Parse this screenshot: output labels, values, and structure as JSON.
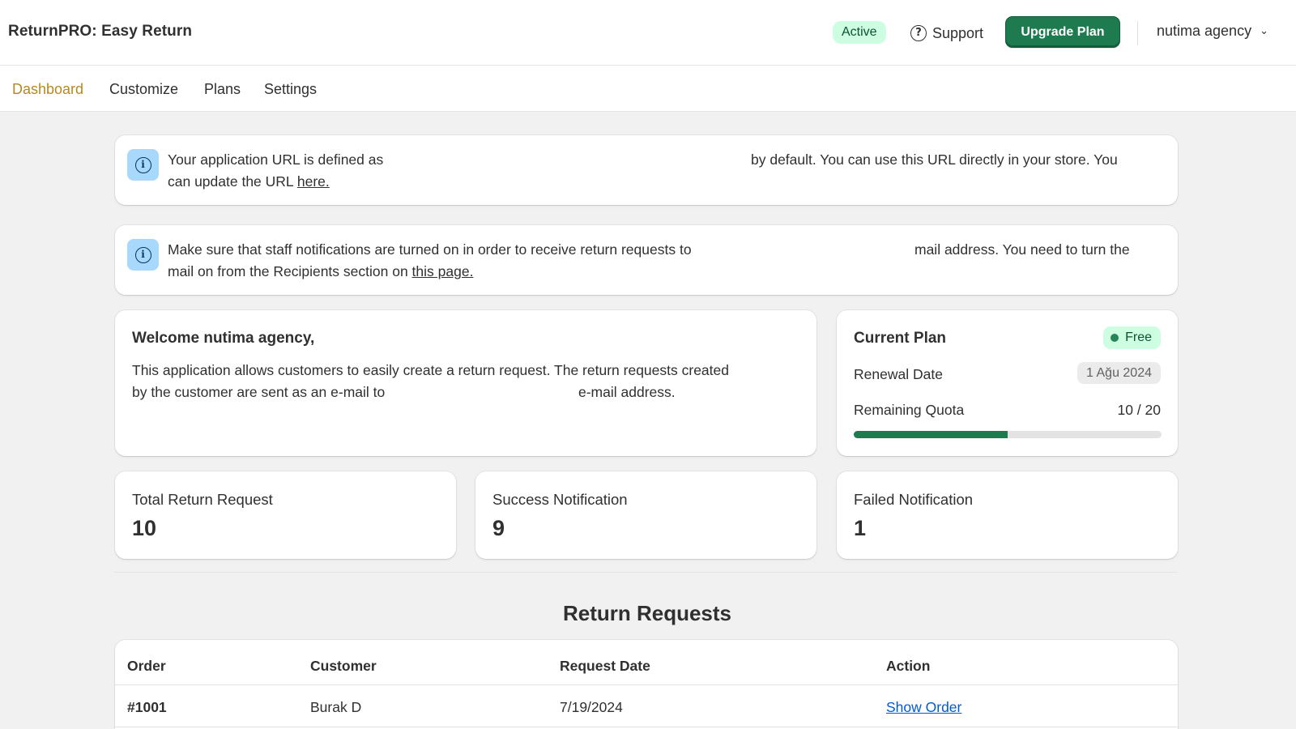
{
  "app": {
    "title": "ReturnPRO: Easy Return",
    "status_badge": "Active",
    "support_label": "Support",
    "upgrade_label": "Upgrade Plan",
    "account_name": "nutima agency"
  },
  "nav": {
    "items": [
      {
        "label": "Dashboard",
        "active": true
      },
      {
        "label": "Customize",
        "active": false
      },
      {
        "label": "Plans",
        "active": false
      },
      {
        "label": "Settings",
        "active": false
      }
    ]
  },
  "banners": {
    "url": {
      "line1_a": "Your application URL is defined as",
      "line1_b": "by default. You can use this URL directly in your store. You",
      "line2_text": "can update the URL ",
      "line2_link": "here."
    },
    "notifications": {
      "line1_a": "Make sure that staff notifications are turned on in order to receive return requests to",
      "line1_b": "mail address. You need to turn the",
      "line2_text": "mail on from the Recipients section on ",
      "line2_link": "this page."
    }
  },
  "welcome": {
    "title": "Welcome nutima agency,",
    "line1": "This application allows customers to easily create a return request. The return requests created",
    "line2_a": "by the customer are sent as an e-mail to",
    "line2_b": "e-mail address."
  },
  "plan": {
    "title": "Current Plan",
    "badge": "Free",
    "renewal_label": "Renewal Date",
    "renewal_date": "1 Ağu 2024",
    "quota_label": "Remaining Quota",
    "quota_value": "10 / 20",
    "quota_used": 10,
    "quota_total": 20,
    "progress_color": "#1e7a4f"
  },
  "stats": [
    {
      "label": "Total Return Request",
      "value": "10"
    },
    {
      "label": "Success Notification",
      "value": "9"
    },
    {
      "label": "Failed Notification",
      "value": "1"
    }
  ],
  "requests": {
    "title": "Return Requests",
    "columns": [
      "Order",
      "Customer",
      "Request Date",
      "Action"
    ],
    "rows": [
      {
        "order": "#1001",
        "customer": "Burak D",
        "date": "7/19/2024",
        "action": "Show Order"
      }
    ]
  }
}
